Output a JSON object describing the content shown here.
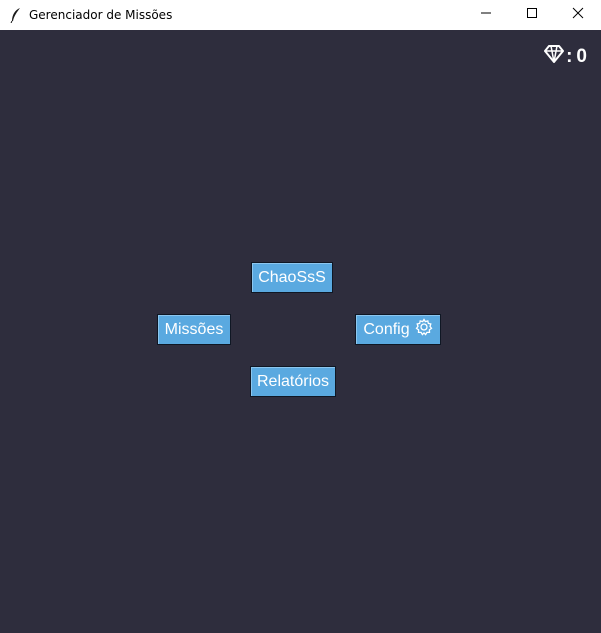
{
  "window": {
    "title": "Gerenciador de Missões",
    "icons": {
      "app": "feather-icon",
      "minimize": "minimize-icon",
      "maximize": "maximize-icon",
      "close": "close-icon"
    }
  },
  "header": {
    "gem_icon": "diamond-icon",
    "gem_separator": ":",
    "gem_count": "0"
  },
  "menu": {
    "chaos_label": "ChaoSsS",
    "missoes_label": "Missões",
    "config_label": "Config",
    "config_icon": "gear-icon",
    "relatorios_label": "Relatórios"
  },
  "colors": {
    "background": "#2e2d3d",
    "button": "#5aa9e0",
    "button_text": "#ffffff"
  }
}
